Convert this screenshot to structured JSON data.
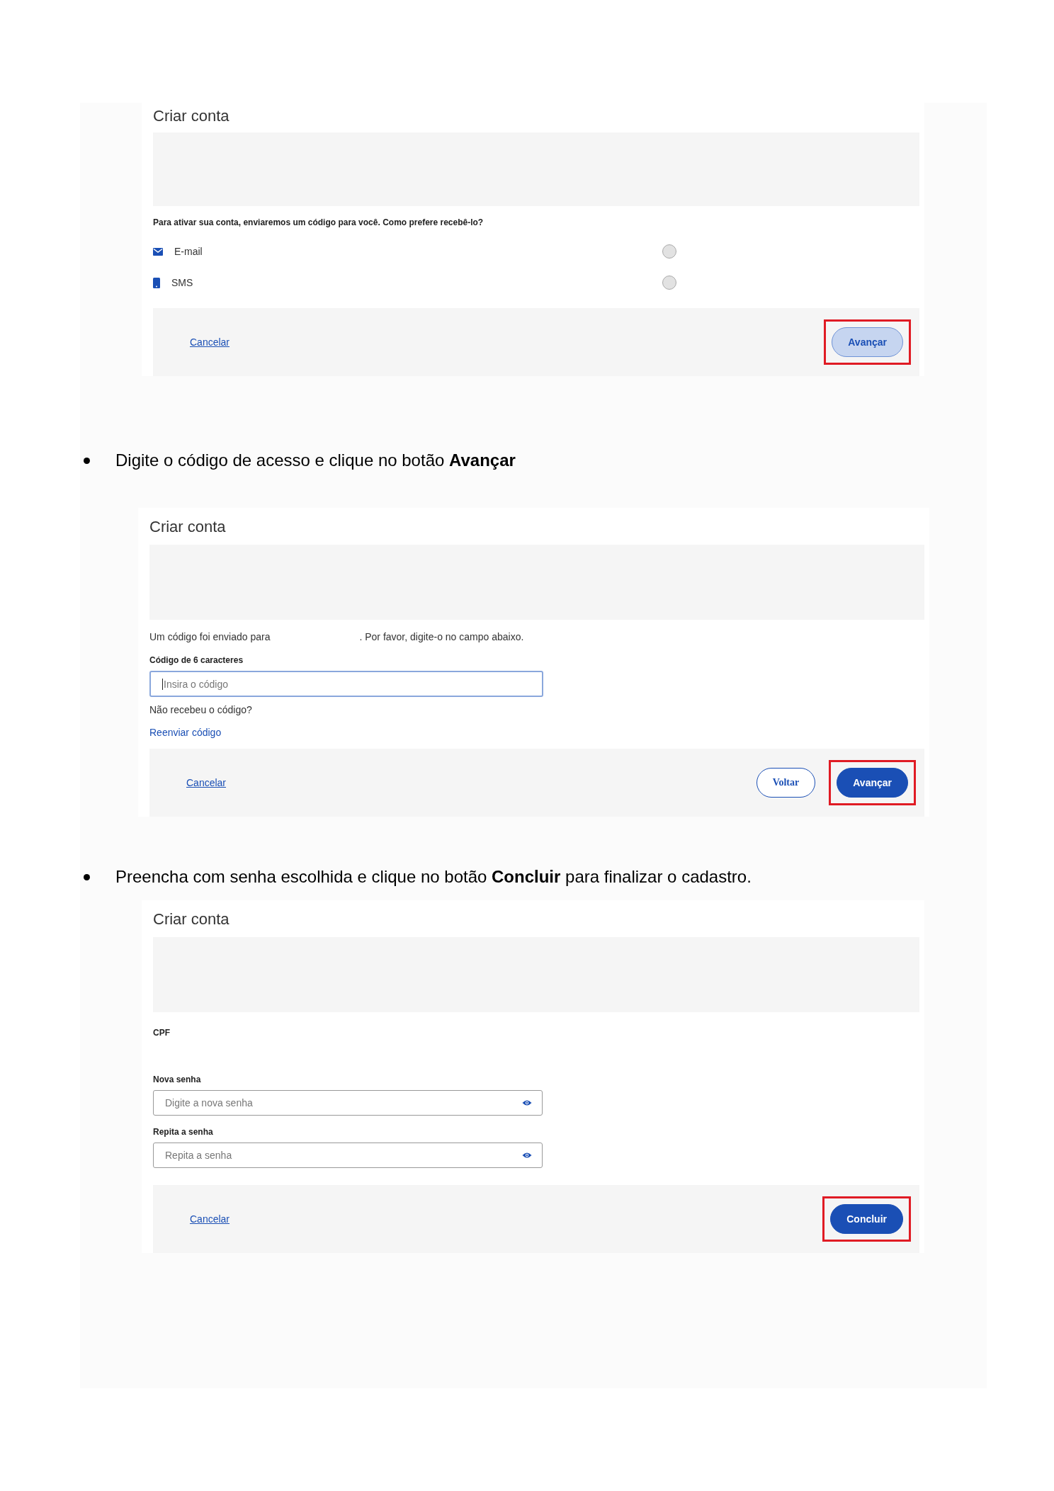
{
  "sections": [
    {
      "kind": "screen",
      "title": "Criar conta",
      "body": [
        {
          "kind": "prompt",
          "text": "Para ativar sua conta, enviaremos um código para você. Como prefere recebê-lo?"
        },
        {
          "kind": "email_option",
          "label": "E-mail",
          "selected": false
        },
        {
          "kind": "sms_option",
          "label": "SMS",
          "selected": false
        }
      ],
      "footer": {
        "cancel": "Cancelar",
        "buttons": [
          {
            "label": "Avançar",
            "kind": "primary",
            "disabled": true,
            "highlighted": true
          }
        ]
      }
    },
    {
      "kind": "bullet",
      "text": "Digite o código de acesso e clique no botão **Avançar**"
    },
    {
      "kind": "screen",
      "title": "Criar conta",
      "body": [
        {
          "kind": "text",
          "text": "Um código foi enviado para",
          "text_after": ". Por favor, digite-o no campo abaixo."
        },
        {
          "kind": "label",
          "text": "Código de 6 caracteres"
        },
        {
          "kind": "input",
          "placeholder": "Insira o código",
          "focused": true
        },
        {
          "kind": "text",
          "text": "Não recebeu o código?"
        },
        {
          "kind": "link",
          "text": "Reenviar código"
        }
      ],
      "footer": {
        "cancel": "Cancelar",
        "buttons": [
          {
            "label": "Voltar",
            "kind": "secondary",
            "disabled": false,
            "highlighted": false
          },
          {
            "label": "Avançar",
            "kind": "primary",
            "disabled": false,
            "highlighted": true
          }
        ]
      }
    },
    {
      "kind": "bullet",
      "text": "Preencha com senha escolhida e clique no botão **Concluir** para finalizar o cadastro."
    },
    {
      "kind": "screen",
      "title": "Criar conta",
      "body": [
        {
          "kind": "value_label",
          "text": "CPF"
        },
        {
          "kind": "label",
          "text": "Nova senha"
        },
        {
          "kind": "password",
          "placeholder": "Digite a nova senha"
        },
        {
          "kind": "label",
          "text": "Repita a senha"
        },
        {
          "kind": "password",
          "placeholder": "Repita a senha"
        }
      ],
      "footer": {
        "cancel": "Cancelar",
        "buttons": [
          {
            "label": "Concluir",
            "kind": "primary",
            "disabled": false,
            "highlighted": true
          }
        ]
      }
    }
  ]
}
